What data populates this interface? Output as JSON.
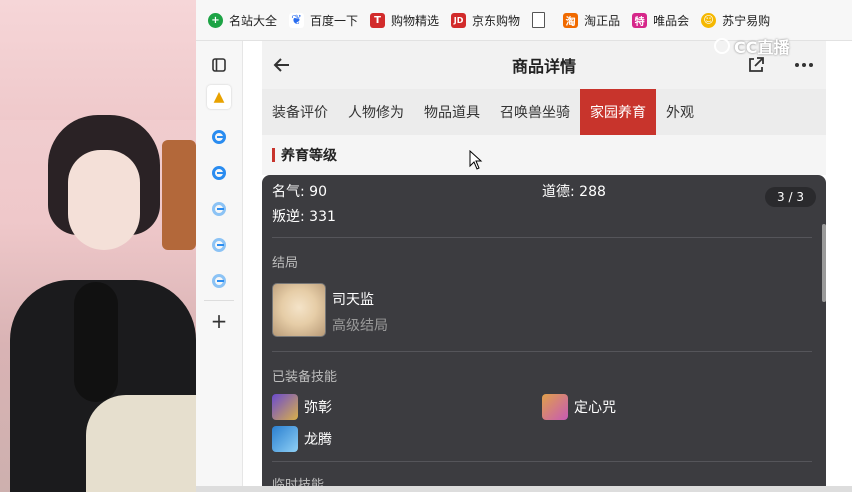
{
  "bookmarks": [
    {
      "label": "名站大全",
      "icon": "site-nav-icon",
      "color": "#1da345"
    },
    {
      "label": "百度一下",
      "icon": "baidu-paw-icon",
      "color": "#2a6df0"
    },
    {
      "label": "购物精选",
      "icon": "t-shop-icon",
      "color": "#d22b2b"
    },
    {
      "label": "京东购物",
      "icon": "jd-icon",
      "color": "#d22b2b"
    },
    {
      "label": "",
      "icon": "document-icon",
      "color": "#666666"
    },
    {
      "label": "淘正品",
      "icon": "taobao-icon",
      "color": "#f06a00"
    },
    {
      "label": "唯品会",
      "icon": "vip-icon",
      "color": "#d6278a"
    },
    {
      "label": "苏宁易购",
      "icon": "suning-icon",
      "color": "#f5b800"
    }
  ],
  "watermark": "CC直播",
  "header": {
    "title": "商品详情"
  },
  "tabs": [
    "装备评价",
    "人物修为",
    "物品道具",
    "召唤兽坐骑",
    "家园养育",
    "外观"
  ],
  "active_tab": "家园养育",
  "section": {
    "title": "养育等级"
  },
  "card": {
    "pager": "3 / 3",
    "stats": {
      "fame": "名气: 90",
      "morality": "道德: 288",
      "rebellion": "叛逆: 331"
    },
    "ending": {
      "heading": "结局",
      "name": "司天监",
      "level": "高级结局"
    },
    "skills": {
      "heading": "已装备技能",
      "items": [
        "弥彰",
        "定心咒",
        "龙腾"
      ]
    },
    "next_heading": "临时技能"
  },
  "colors": {
    "accent": "#c8342c",
    "card_bg": "#3c3c40"
  }
}
